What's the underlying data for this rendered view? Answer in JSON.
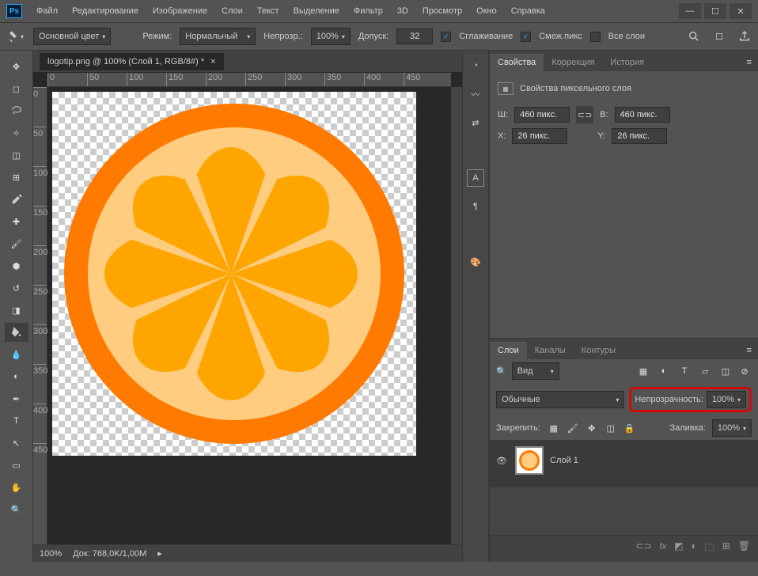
{
  "menu": [
    "Файл",
    "Редактирование",
    "Изображение",
    "Слои",
    "Текст",
    "Выделение",
    "Фильтр",
    "3D",
    "Просмотр",
    "Окно",
    "Справка"
  ],
  "options": {
    "fill_dropdown": "Основной цвет",
    "mode_label": "Режим:",
    "mode_value": "Нормальный",
    "opacity_label": "Непрозр.:",
    "opacity_value": "100%",
    "tolerance_label": "Допуск:",
    "tolerance_value": "32",
    "antialias": "Сглаживание",
    "contiguous": "Смеж.пикс",
    "all_layers": "Все слои"
  },
  "document": {
    "tab_title": "logotip.png @ 100% (Слой 1, RGB/8#) *"
  },
  "ruler_h": [
    "0",
    "50",
    "100",
    "150",
    "200",
    "250",
    "300",
    "350",
    "400",
    "450"
  ],
  "ruler_v": [
    "0",
    "50",
    "100",
    "150",
    "200",
    "250",
    "300",
    "350",
    "400",
    "450"
  ],
  "status": {
    "zoom": "100%",
    "doc": "Док: 768,0K/1,00M"
  },
  "panels": {
    "properties": {
      "tab1": "Свойства",
      "tab2": "Коррекция",
      "tab3": "История",
      "subtitle": "Свойства пиксельного слоя",
      "w_label": "Ш:",
      "w_value": "460 пикс.",
      "h_label": "В:",
      "h_value": "460 пикс.",
      "x_label": "X:",
      "x_value": "26 пикс.",
      "y_label": "Y:",
      "y_value": "26 пикс."
    },
    "layers": {
      "tab1": "Слои",
      "tab2": "Каналы",
      "tab3": "Контуры",
      "search_label": "Вид",
      "blend_mode": "Обычные",
      "opacity_label": "Непрозрачность:",
      "opacity_value": "100%",
      "lock_label": "Закрепить:",
      "fill_label": "Заливка:",
      "fill_value": "100%",
      "layer1_name": "Слой 1"
    }
  }
}
